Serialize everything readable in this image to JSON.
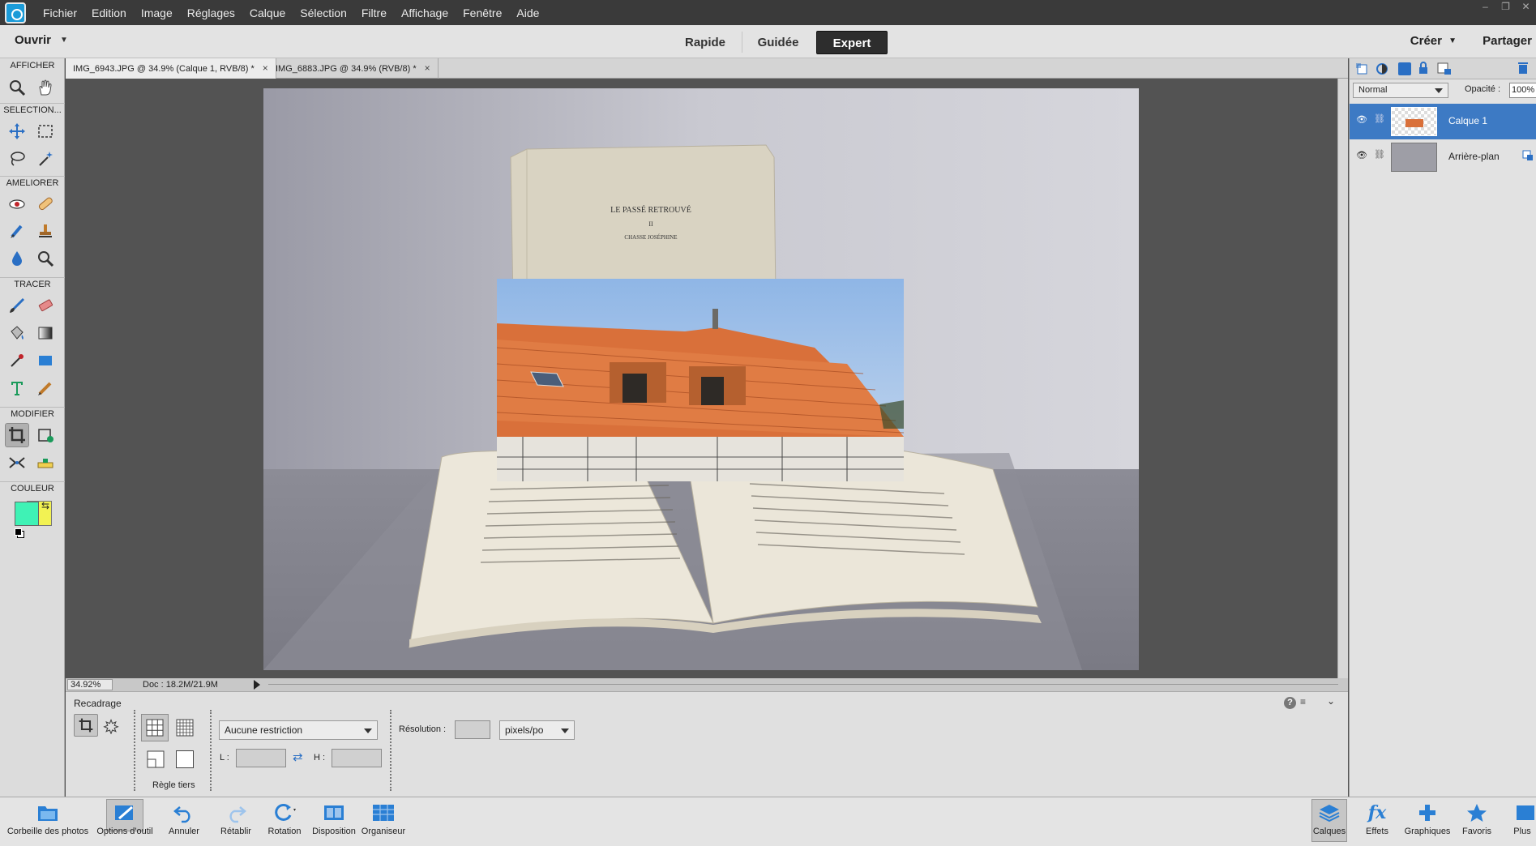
{
  "menubar": {
    "items": [
      "Fichier",
      "Edition",
      "Image",
      "Réglages",
      "Calque",
      "Sélection",
      "Filtre",
      "Affichage",
      "Fenêtre",
      "Aide"
    ]
  },
  "modebar": {
    "open_label": "Ouvrir",
    "modes": [
      "Rapide",
      "Guidée",
      "Expert"
    ],
    "active_mode": "Expert",
    "create_label": "Créer",
    "share_label": "Partager"
  },
  "toolbox": {
    "sections": [
      "AFFICHER",
      "SELECTION...",
      "AMELIORER",
      "TRACER",
      "MODIFIER",
      "COULEUR"
    ],
    "foreground_color": "#3ff2b5",
    "background_color": "#f2f253"
  },
  "document_tabs": [
    {
      "label": "IMG_6943.JPG @ 34.9% (Calque 1, RVB/8) *",
      "close": "×"
    },
    {
      "label": "IMG_6883.JPG @ 34.9% (RVB/8) *",
      "close": "×"
    }
  ],
  "canvas": {
    "book_title_lines": [
      "LE PASSÉ RETROUVÉ",
      "II",
      "CHASSE JOSÉPHINE"
    ]
  },
  "statusbar": {
    "zoom": "34.92%",
    "doc_info": "Doc : 18.2M/21.9M"
  },
  "tool_options": {
    "tool_name": "Recadrage",
    "restriction": "Aucune restriction",
    "width_label": "L :",
    "height_label": "H :",
    "resolution_label": "Résolution :",
    "resolution_unit": "pixels/po",
    "overlay_label": "Règle tiers",
    "help_icon": "?"
  },
  "layers_panel": {
    "blend_mode": "Normal",
    "opacity_label": "Opacité :",
    "opacity_value": "100%",
    "layers": [
      {
        "name": "Calque 1",
        "selected": true
      },
      {
        "name": "Arrière-plan",
        "selected": false
      }
    ]
  },
  "taskbar": {
    "left_items": [
      "Corbeille des photos",
      "Options d'outil",
      "Annuler",
      "Rétablir",
      "Rotation",
      "Disposition",
      "Organiseur"
    ],
    "right_items": [
      "Calques",
      "Effets",
      "Graphiques",
      "Favoris",
      "Plus"
    ]
  }
}
